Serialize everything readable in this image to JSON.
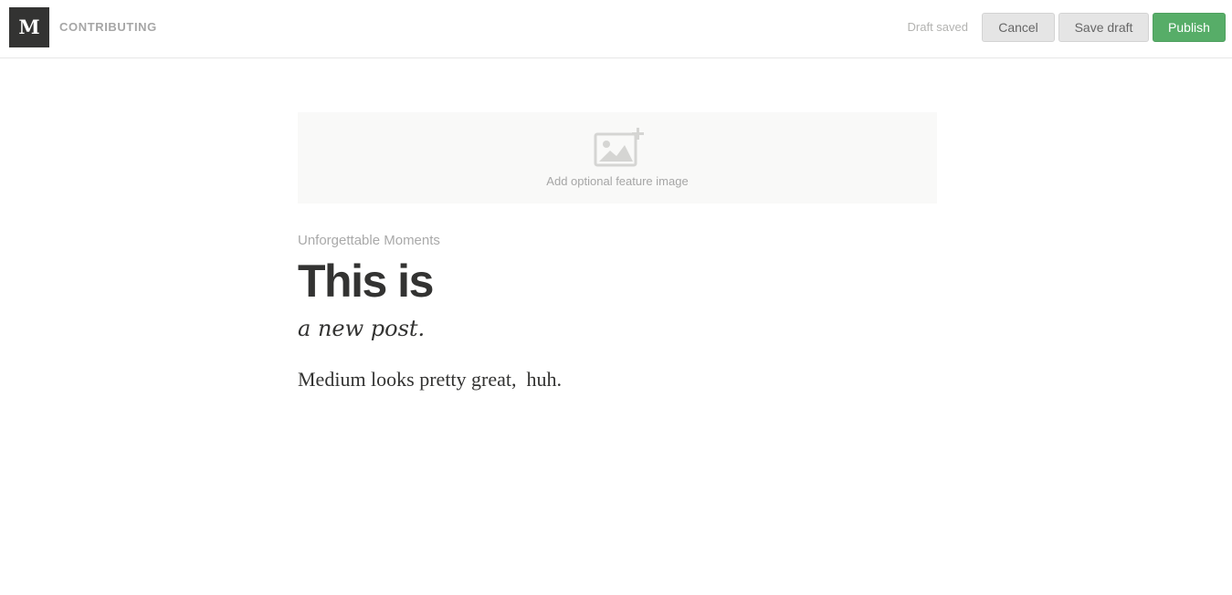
{
  "header": {
    "logo_letter": "M",
    "section_name": "CONTRIBUTING",
    "draft_status": "Draft saved",
    "cancel_label": "Cancel",
    "save_draft_label": "Save draft",
    "publish_label": "Publish",
    "publish_color": "#57ad68"
  },
  "feature_image": {
    "icon": "image-add-icon",
    "label": "Add optional feature image"
  },
  "post": {
    "collection": "Unforgettable Moments",
    "title": "This is",
    "subtitle": "a new post.",
    "body": "Medium looks pretty great,  huh."
  }
}
